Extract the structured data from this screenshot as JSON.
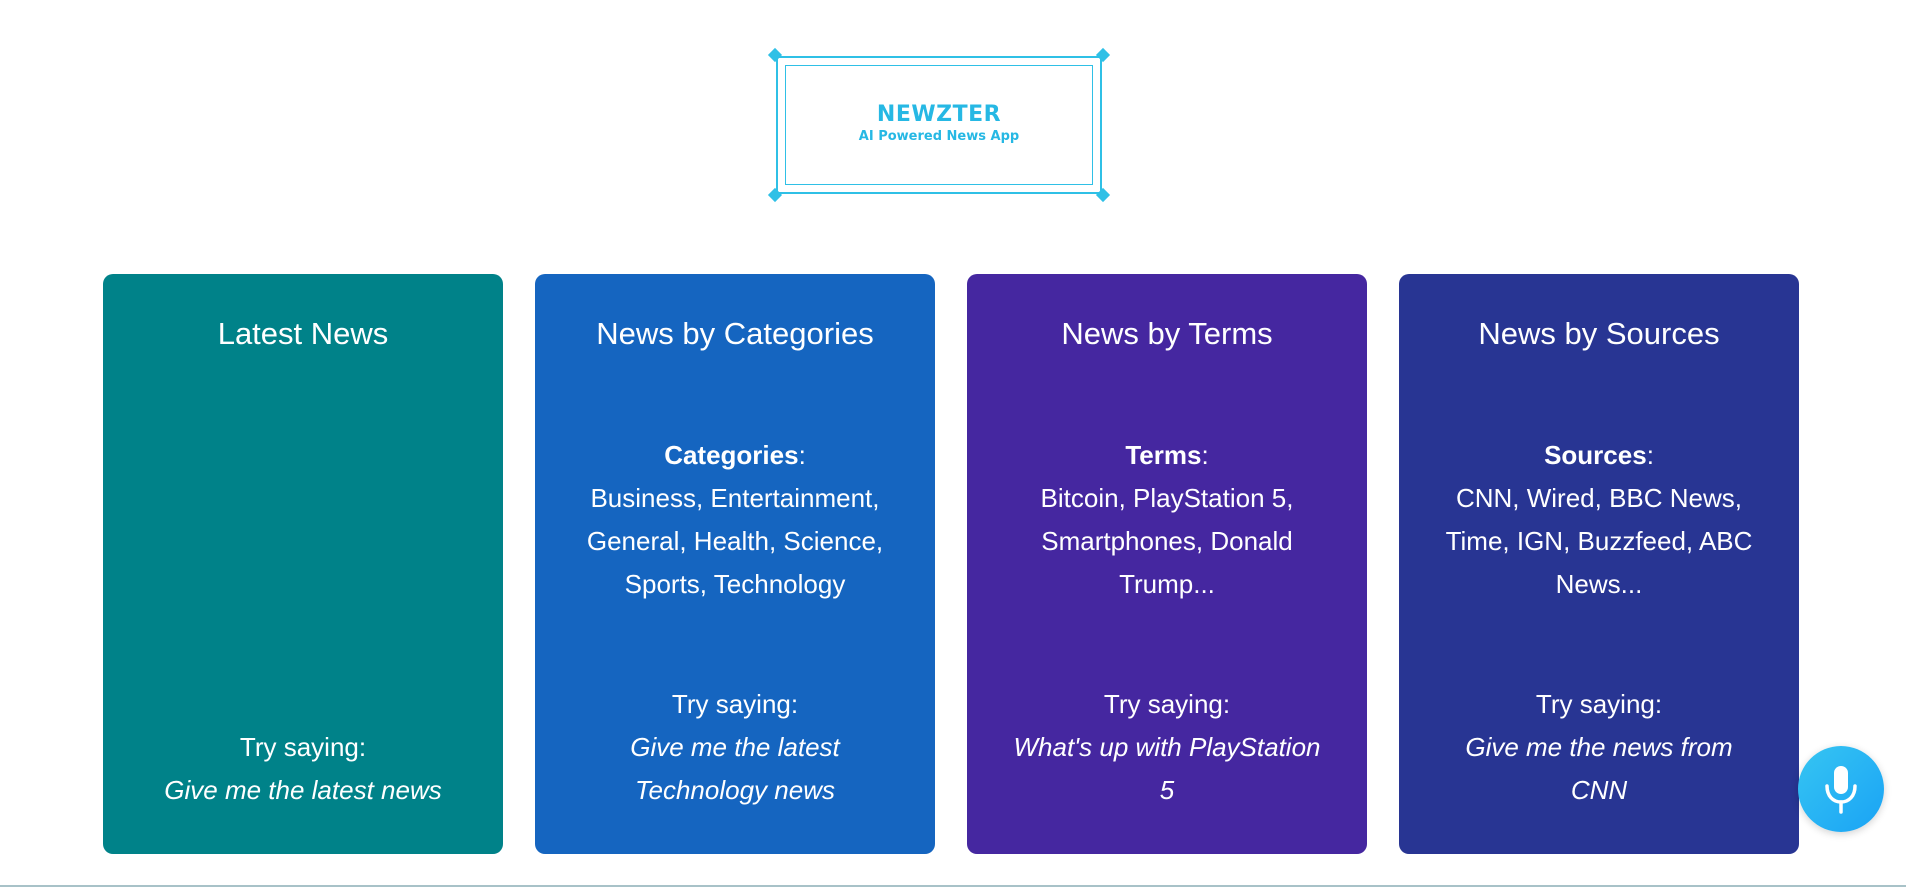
{
  "logo": {
    "title": "NEWZTER",
    "subtitle": "AI Powered News App"
  },
  "cards": [
    {
      "title": "Latest News",
      "color": "#008289",
      "info_label": "",
      "info_text": "",
      "try_label": "Try saying:",
      "try_example": "Give me the latest news"
    },
    {
      "title": "News by Categories",
      "color": "#1565c0",
      "info_label": "Categories",
      "info_text": "Business, Entertainment, General, Health, Science, Sports, Technology",
      "try_label": "Try saying:",
      "try_example": "Give me the latest Technology news"
    },
    {
      "title": "News by Terms",
      "color": "#4527a0",
      "info_label": "Terms",
      "info_text": "Bitcoin, PlayStation 5, Smartphones, Donald Trump...",
      "try_label": "Try saying:",
      "try_example": "What's up with PlayStation 5"
    },
    {
      "title": "News by Sources",
      "color": "#283593",
      "info_label": "Sources",
      "info_text": "CNN, Wired, BBC News, Time, IGN, Buzzfeed, ABC News...",
      "try_label": "Try saying:",
      "try_example": "Give me the news from CNN"
    }
  ],
  "mic": {
    "icon": "microphone-icon",
    "color": "#1aa3f5"
  }
}
